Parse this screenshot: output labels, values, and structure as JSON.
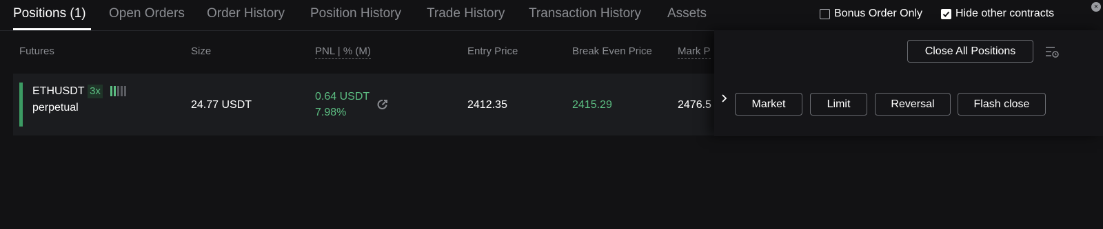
{
  "tabs": {
    "positions": "Positions (1)",
    "open_orders": "Open Orders",
    "order_history": "Order History",
    "position_history": "Position History",
    "trade_history": "Trade History",
    "transaction_history": "Transaction History",
    "assets": "Assets"
  },
  "toggles": {
    "bonus_order_only": {
      "label": "Bonus Order Only",
      "checked": false
    },
    "hide_other_contracts": {
      "label": "Hide other contracts",
      "checked": true
    }
  },
  "columns": {
    "futures": "Futures",
    "size": "Size",
    "pnl": "PNL | % (M)",
    "entry_price": "Entry Price",
    "break_even_price": "Break Even Price",
    "mark_price": "Mark P"
  },
  "position": {
    "symbol": "ETHUSDT",
    "leverage": "3x",
    "type": "perpetual",
    "size": "24.77 USDT",
    "pnl_value": "0.64 USDT",
    "pnl_percent": "7.98%",
    "entry_price": "2412.35",
    "break_even_price": "2415.29",
    "mark_price": "2476.5"
  },
  "actions": {
    "close_all": "Close All Positions",
    "market": "Market",
    "limit": "Limit",
    "reversal": "Reversal",
    "flash_close": "Flash close"
  },
  "colors": {
    "background": "#121214",
    "profit_green": "#5cbe82",
    "muted_text": "#8a8c91"
  }
}
